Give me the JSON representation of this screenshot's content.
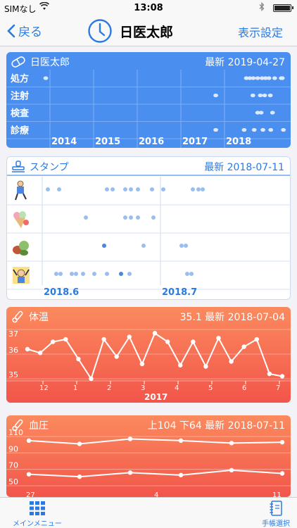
{
  "status_bar": {
    "carrier": "SIMなし",
    "time": "13:08"
  },
  "nav": {
    "back_label": "戻る",
    "title": "日医太郎",
    "settings_label": "表示設定"
  },
  "summary_card": {
    "title": "日医太郎",
    "latest": "最新 2019-04-27",
    "rows": [
      "処方",
      "注射",
      "検査",
      "診療"
    ],
    "years": [
      "2014",
      "2015",
      "2016",
      "2017",
      "2018"
    ],
    "dots": [
      [
        [
          2019.55,
          0
        ],
        [
          2018.5,
          0
        ],
        [
          2018.58,
          0
        ],
        [
          2018.66,
          0
        ],
        [
          2018.76,
          0
        ],
        [
          2018.86,
          0
        ],
        [
          2018.94,
          0
        ],
        [
          2019.02,
          0
        ],
        [
          2019.15,
          0
        ],
        [
          2019.3,
          0
        ],
        [
          2019.9,
          0
        ],
        [
          2013.4,
          0
        ]
      ],
      [
        [
          2017.8,
          1
        ],
        [
          2018.65,
          1
        ],
        [
          2018.82,
          1
        ],
        [
          2018.92,
          1
        ],
        [
          2019.05,
          1
        ]
      ],
      [
        [
          2018.76,
          2
        ],
        [
          2018.84,
          2
        ],
        [
          2019.1,
          2
        ]
      ],
      [
        [
          2017.8,
          3
        ],
        [
          2018.45,
          3
        ],
        [
          2018.68,
          3
        ],
        [
          2018.88,
          3
        ],
        [
          2019.06,
          3
        ],
        [
          2019.35,
          3
        ]
      ]
    ],
    "colors": {
      "bg": "#4a8ef0",
      "dot": "#dde8fb"
    }
  },
  "stamp_card": {
    "title": "スタンプ",
    "latest": "最新 2018-07-11",
    "row_icons": [
      "walking-person-icon",
      "ice-cream-icon",
      "vegetables-icon",
      "distressed-person-icon"
    ],
    "months": [
      "2018.6",
      "2018.7"
    ],
    "colors": {
      "dot": "#9bbef0",
      "dot_dark": "#4a86e0",
      "accent": "#2a7ae2"
    }
  },
  "temp_card": {
    "title": "体温",
    "latest": "35.1 最新 2018-07-04",
    "y_ticks": [
      "37",
      "36",
      "35"
    ],
    "x_ticks": [
      "12",
      "1",
      "2",
      "3",
      "4",
      "5",
      "6",
      "7"
    ],
    "year_label": "2017",
    "chart_data": {
      "type": "line",
      "title": "体温",
      "ylim": [
        35,
        37
      ],
      "x_labels": [
        "12",
        "1",
        "2",
        "3",
        "4",
        "5",
        "6",
        "7"
      ],
      "series": [
        {
          "values": [
            36.2,
            36.05,
            36.5,
            36.6,
            35.8,
            35.0,
            36.6,
            35.9,
            36.7,
            35.6,
            36.85,
            36.5,
            35.55,
            36.5,
            35.5,
            36.65,
            35.7,
            36.3,
            36.6,
            35.2,
            35.1
          ]
        }
      ]
    }
  },
  "bp_card": {
    "title": "血圧",
    "latest": "上104 下64 最新 2018-07-11",
    "y_ticks": [
      "110",
      "90",
      "70",
      "50"
    ],
    "x_ticks": [
      "27",
      "4",
      "11"
    ],
    "chart_data": {
      "type": "line",
      "title": "血圧",
      "ylim": [
        50,
        110
      ],
      "series": [
        {
          "values": [
            105,
            101,
            107,
            105,
            102,
            103
          ]
        },
        {
          "values": [
            64,
            61,
            66,
            63,
            69,
            65
          ]
        }
      ]
    }
  },
  "tab_bar": {
    "menu_label": "メインメニュー",
    "notebook_label": "手帳選択"
  }
}
